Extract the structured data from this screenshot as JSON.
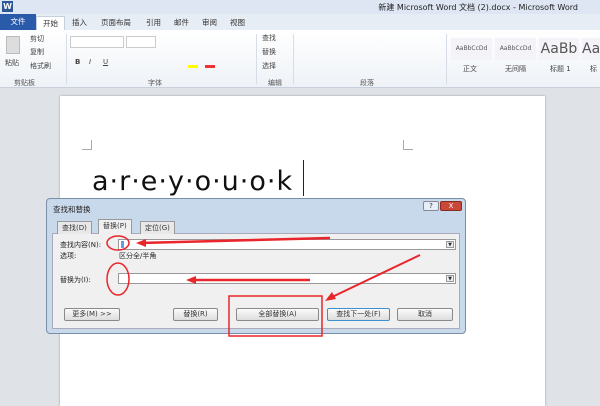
{
  "window": {
    "title": "新建 Microsoft Word 文档 (2).docx - Microsoft Word",
    "logo": "W"
  },
  "ribbon_tabs": [
    "文件",
    "开始",
    "插入",
    "页面布局",
    "引用",
    "邮件",
    "审阅",
    "视图"
  ],
  "clipboard": {
    "paste": "粘贴",
    "cut": "剪切",
    "copy": "复制",
    "format_painter": "格式刷",
    "group": "剪贴板"
  },
  "font": {
    "group": "字体",
    "bold": "B",
    "italic": "I",
    "underline": "U"
  },
  "editing": {
    "find": "查找",
    "replace": "替换",
    "select": "选择",
    "group": "编辑"
  },
  "paragraph": {
    "group": "段落"
  },
  "styles": [
    {
      "preview": "AaBbCcDd",
      "name": "正文"
    },
    {
      "preview": "AaBbCcDd",
      "name": "无间隔"
    },
    {
      "preview": "AaBb",
      "name": "标题 1"
    },
    {
      "preview": "Aa",
      "name": "标"
    }
  ],
  "document": {
    "text": "a·r·e·y·o·u·o·k"
  },
  "dialog": {
    "title": "查找和替换",
    "help": "?",
    "close": "X",
    "tabs": [
      "查找(D)",
      "替换(P)",
      "定位(G)"
    ],
    "active_tab": "替换(P)",
    "find_label": "查找内容(N):",
    "find_value": "",
    "options_label": "选项:",
    "options_value": "区分全/半角",
    "replace_label": "替换为(I):",
    "replace_value": "",
    "buttons": {
      "more": "更多(M) >>",
      "replace": "替换(R)",
      "replace_all": "全部替换(A)",
      "find_next": "查找下一处(F)",
      "cancel": "取消"
    }
  },
  "annotation_color": "#e8262b"
}
